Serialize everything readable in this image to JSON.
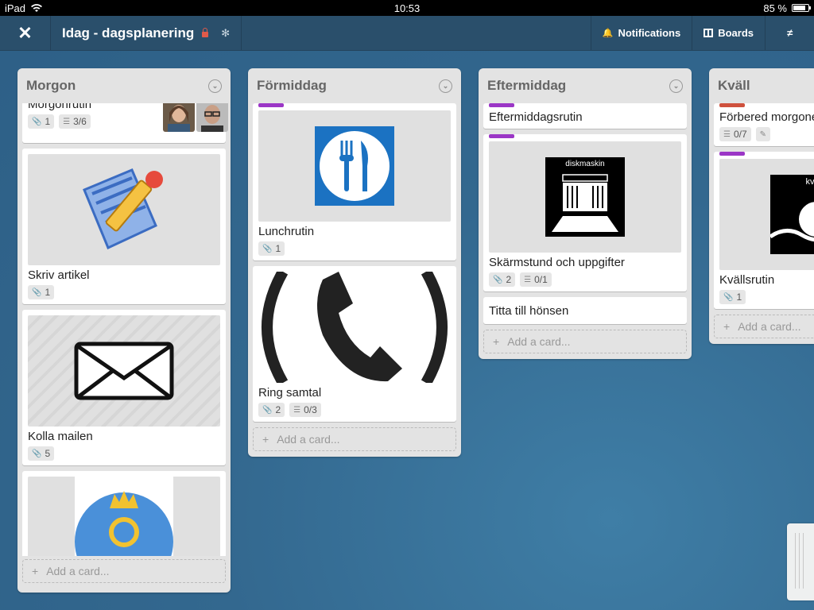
{
  "statusbar": {
    "device": "iPad",
    "time": "10:53",
    "battery": "85 %",
    "battery_level": 0.85
  },
  "header": {
    "close_glyph": "✕",
    "board_title": "Idag - dagsplanering",
    "notifications_label": "Notifications",
    "boards_label": "Boards",
    "menu_glyph": "≠"
  },
  "add_card_label": "Add a card...",
  "lists": [
    {
      "name": "Morgon",
      "cards": [
        {
          "title": "Morgonrutin",
          "attachments": "1",
          "checklist": "3/6"
        },
        {
          "title": "Skriv artikel",
          "attachments": "1"
        },
        {
          "title": "Kolla mailen",
          "attachments": "5"
        }
      ]
    },
    {
      "name": "Förmiddag",
      "cards": [
        {
          "title": "Lunchrutin",
          "attachments": "1",
          "label_color": "#9b36c6"
        },
        {
          "title": "Ring samtal",
          "attachments": "2",
          "checklist": "0/3"
        }
      ]
    },
    {
      "name": "Eftermiddag",
      "cards": [
        {
          "title": "Eftermiddagsrutin",
          "label_color": "#9b36c6"
        },
        {
          "title": "Skärmstund och uppgifter",
          "attachments": "2",
          "checklist": "0/1",
          "label_color": "#9b36c6",
          "cover_text": "diskmaskin"
        },
        {
          "title": "Titta till hönsen"
        }
      ]
    },
    {
      "name": "Kväll",
      "cards": [
        {
          "title": "Förbered morgonen",
          "checklist": "0/7",
          "label_color": "#cf513d"
        },
        {
          "title": "Kvällsrutin",
          "attachments": "1",
          "label_color": "#9b36c6",
          "cover_text": "kv"
        }
      ]
    }
  ]
}
